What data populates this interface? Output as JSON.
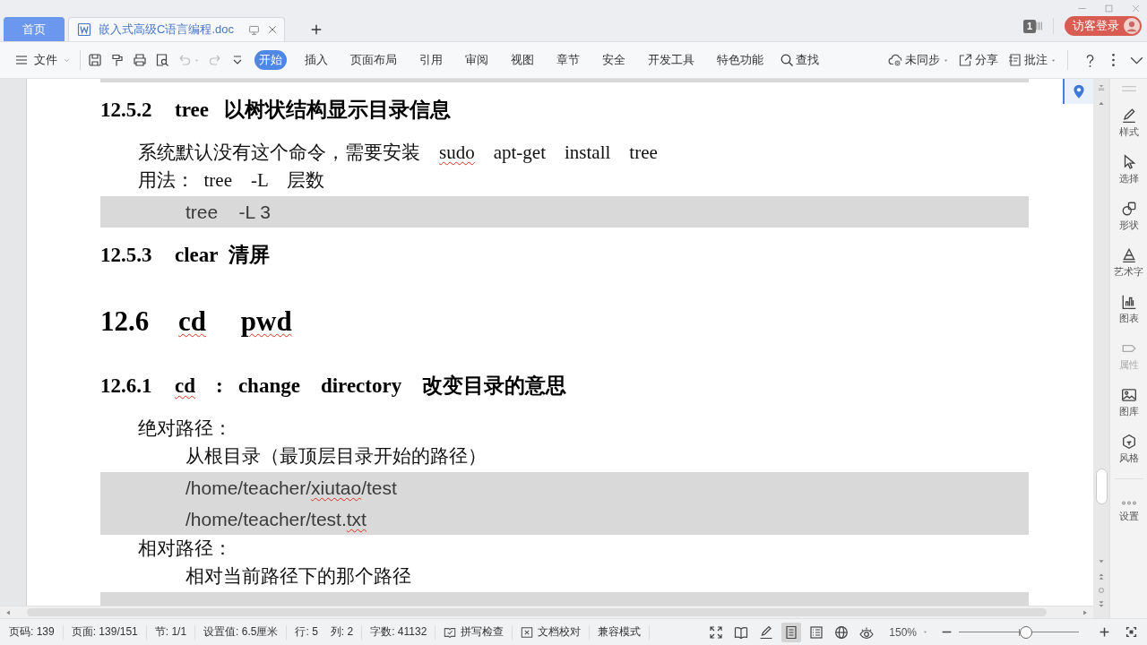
{
  "title_bar": {
    "tabs": [
      {
        "label": "首页",
        "kind": "home",
        "selected": false
      },
      {
        "label": "嵌入式高级C语言编程.doc",
        "kind": "document",
        "selected": true
      }
    ],
    "badge": "1",
    "login_button": "访客登录"
  },
  "toolbar": {
    "file_menu": "文件",
    "quick_tools": [
      {
        "kind": "save",
        "disabled": false,
        "dropdown": false
      },
      {
        "kind": "format_painter",
        "disabled": false,
        "dropdown": false
      },
      {
        "kind": "print",
        "disabled": false,
        "dropdown": false
      },
      {
        "kind": "print_preview",
        "disabled": false,
        "dropdown": false
      },
      {
        "kind": "undo",
        "disabled": true,
        "dropdown": true
      },
      {
        "kind": "redo",
        "disabled": true,
        "dropdown": false
      },
      {
        "kind": "customize",
        "disabled": false,
        "dropdown": false
      }
    ],
    "tabs": [
      {
        "label": "开始",
        "selected": true
      },
      {
        "label": "插入",
        "selected": false
      },
      {
        "label": "页面布局",
        "selected": false
      },
      {
        "label": "引用",
        "selected": false
      },
      {
        "label": "审阅",
        "selected": false
      },
      {
        "label": "视图",
        "selected": false
      },
      {
        "label": "章节",
        "selected": false
      },
      {
        "label": "安全",
        "selected": false
      },
      {
        "label": "开发工具",
        "selected": false
      },
      {
        "label": "特色功能",
        "selected": false
      }
    ],
    "search": "查找",
    "actions": [
      {
        "kind": "sync",
        "label": "未同步",
        "dropdown": true
      },
      {
        "kind": "share",
        "label": "分享",
        "dropdown": false
      },
      {
        "kind": "comment",
        "label": "批注",
        "dropdown": true
      }
    ]
  },
  "document": {
    "blocks": [
      {
        "kind": "code_end"
      },
      {
        "kind": "h3",
        "number": "12.5.2",
        "segments": [
          {
            "text": "tree   以树状结构显示目录信息",
            "spell_error": false
          }
        ]
      },
      {
        "kind": "para",
        "segments": [
          {
            "text": "系统默认没有这个命令，需要安装",
            "spell_error": false
          },
          {
            "text": "    sudo",
            "spell_error": true
          },
          {
            "text": "    apt-get    install    tree",
            "spell_error": false
          }
        ]
      },
      {
        "kind": "para",
        "segments": [
          {
            "text": "用法：  tree    -L    层数",
            "spell_error": false
          }
        ]
      },
      {
        "kind": "code",
        "lines": [
          {
            "segments": [
              {
                "text": "tree    -L 3",
                "spell_error": false
              }
            ]
          }
        ]
      },
      {
        "kind": "h3",
        "number": "12.5.3",
        "segments": [
          {
            "text": "clear  清屏",
            "spell_error": false
          }
        ]
      },
      {
        "kind": "h2",
        "number": "12.6",
        "segments": [
          {
            "text": "cd",
            "spell_error": true
          },
          {
            "text": "     pwd",
            "spell_error": true
          }
        ]
      },
      {
        "kind": "h3",
        "number": "12.6.1",
        "segments": [
          {
            "text": "cd",
            "spell_error": true
          },
          {
            "text": "    :   change    directory    改变目录的意思",
            "spell_error": false
          }
        ]
      },
      {
        "kind": "para",
        "segments": [
          {
            "text": "绝对路径：",
            "spell_error": false
          }
        ]
      },
      {
        "kind": "sub",
        "segments": [
          {
            "text": "从根目录（最顶层目录开始的路径）",
            "spell_error": false
          }
        ]
      },
      {
        "kind": "code",
        "lines": [
          {
            "segments": [
              {
                "text": "/home/teacher/",
                "spell_error": false
              },
              {
                "text": "xiutao",
                "spell_error": true
              },
              {
                "text": "/test",
                "spell_error": false
              }
            ]
          },
          {
            "segments": [
              {
                "text": "/home/teacher/test.",
                "spell_error": false
              },
              {
                "text": "txt",
                "spell_error": true
              }
            ]
          }
        ]
      },
      {
        "kind": "para",
        "segments": [
          {
            "text": "相对路径：",
            "spell_error": false
          }
        ]
      },
      {
        "kind": "sub",
        "segments": [
          {
            "text": "相对当前路径下的那个路径",
            "spell_error": false
          }
        ]
      },
      {
        "kind": "code"
      }
    ]
  },
  "side_panel": {
    "items": [
      {
        "kind": "style",
        "label": "样式",
        "disabled": false
      },
      {
        "kind": "select",
        "label": "选择",
        "disabled": false
      },
      {
        "kind": "shape",
        "label": "形状",
        "disabled": false
      },
      {
        "kind": "wordart",
        "label": "艺术字",
        "disabled": false
      },
      {
        "kind": "chart",
        "label": "图表",
        "disabled": false
      },
      {
        "kind": "property",
        "label": "属性",
        "disabled": true
      },
      {
        "kind": "gallery",
        "label": "图库",
        "disabled": false
      },
      {
        "kind": "theme",
        "label": "风格",
        "disabled": false
      },
      {
        "kind": "settings",
        "label": "设置",
        "disabled": false
      }
    ]
  },
  "status_bar": {
    "fields": [
      [
        "页码: 139"
      ],
      [
        "页面: 139/151"
      ],
      [
        "节: 1/1"
      ],
      [
        "设置值: 6.5厘米"
      ],
      [
        "行: 5",
        "列: 2"
      ],
      [
        "字数: 41132"
      ]
    ],
    "tools": [
      {
        "kind": "spellcheck",
        "label": "拼写检查"
      },
      {
        "kind": "proofread",
        "label": "文档校对"
      }
    ],
    "mode": "兼容模式",
    "views": [
      {
        "kind": "fullscreen",
        "selected": false
      },
      {
        "kind": "reading",
        "selected": false
      },
      {
        "kind": "writing",
        "selected": false
      },
      {
        "kind": "page",
        "selected": true
      },
      {
        "kind": "outline",
        "selected": false
      },
      {
        "kind": "web",
        "selected": false
      },
      {
        "kind": "focus",
        "selected": false
      }
    ],
    "zoom": "150%",
    "zoom_slider": {
      "level": 0.56
    }
  }
}
